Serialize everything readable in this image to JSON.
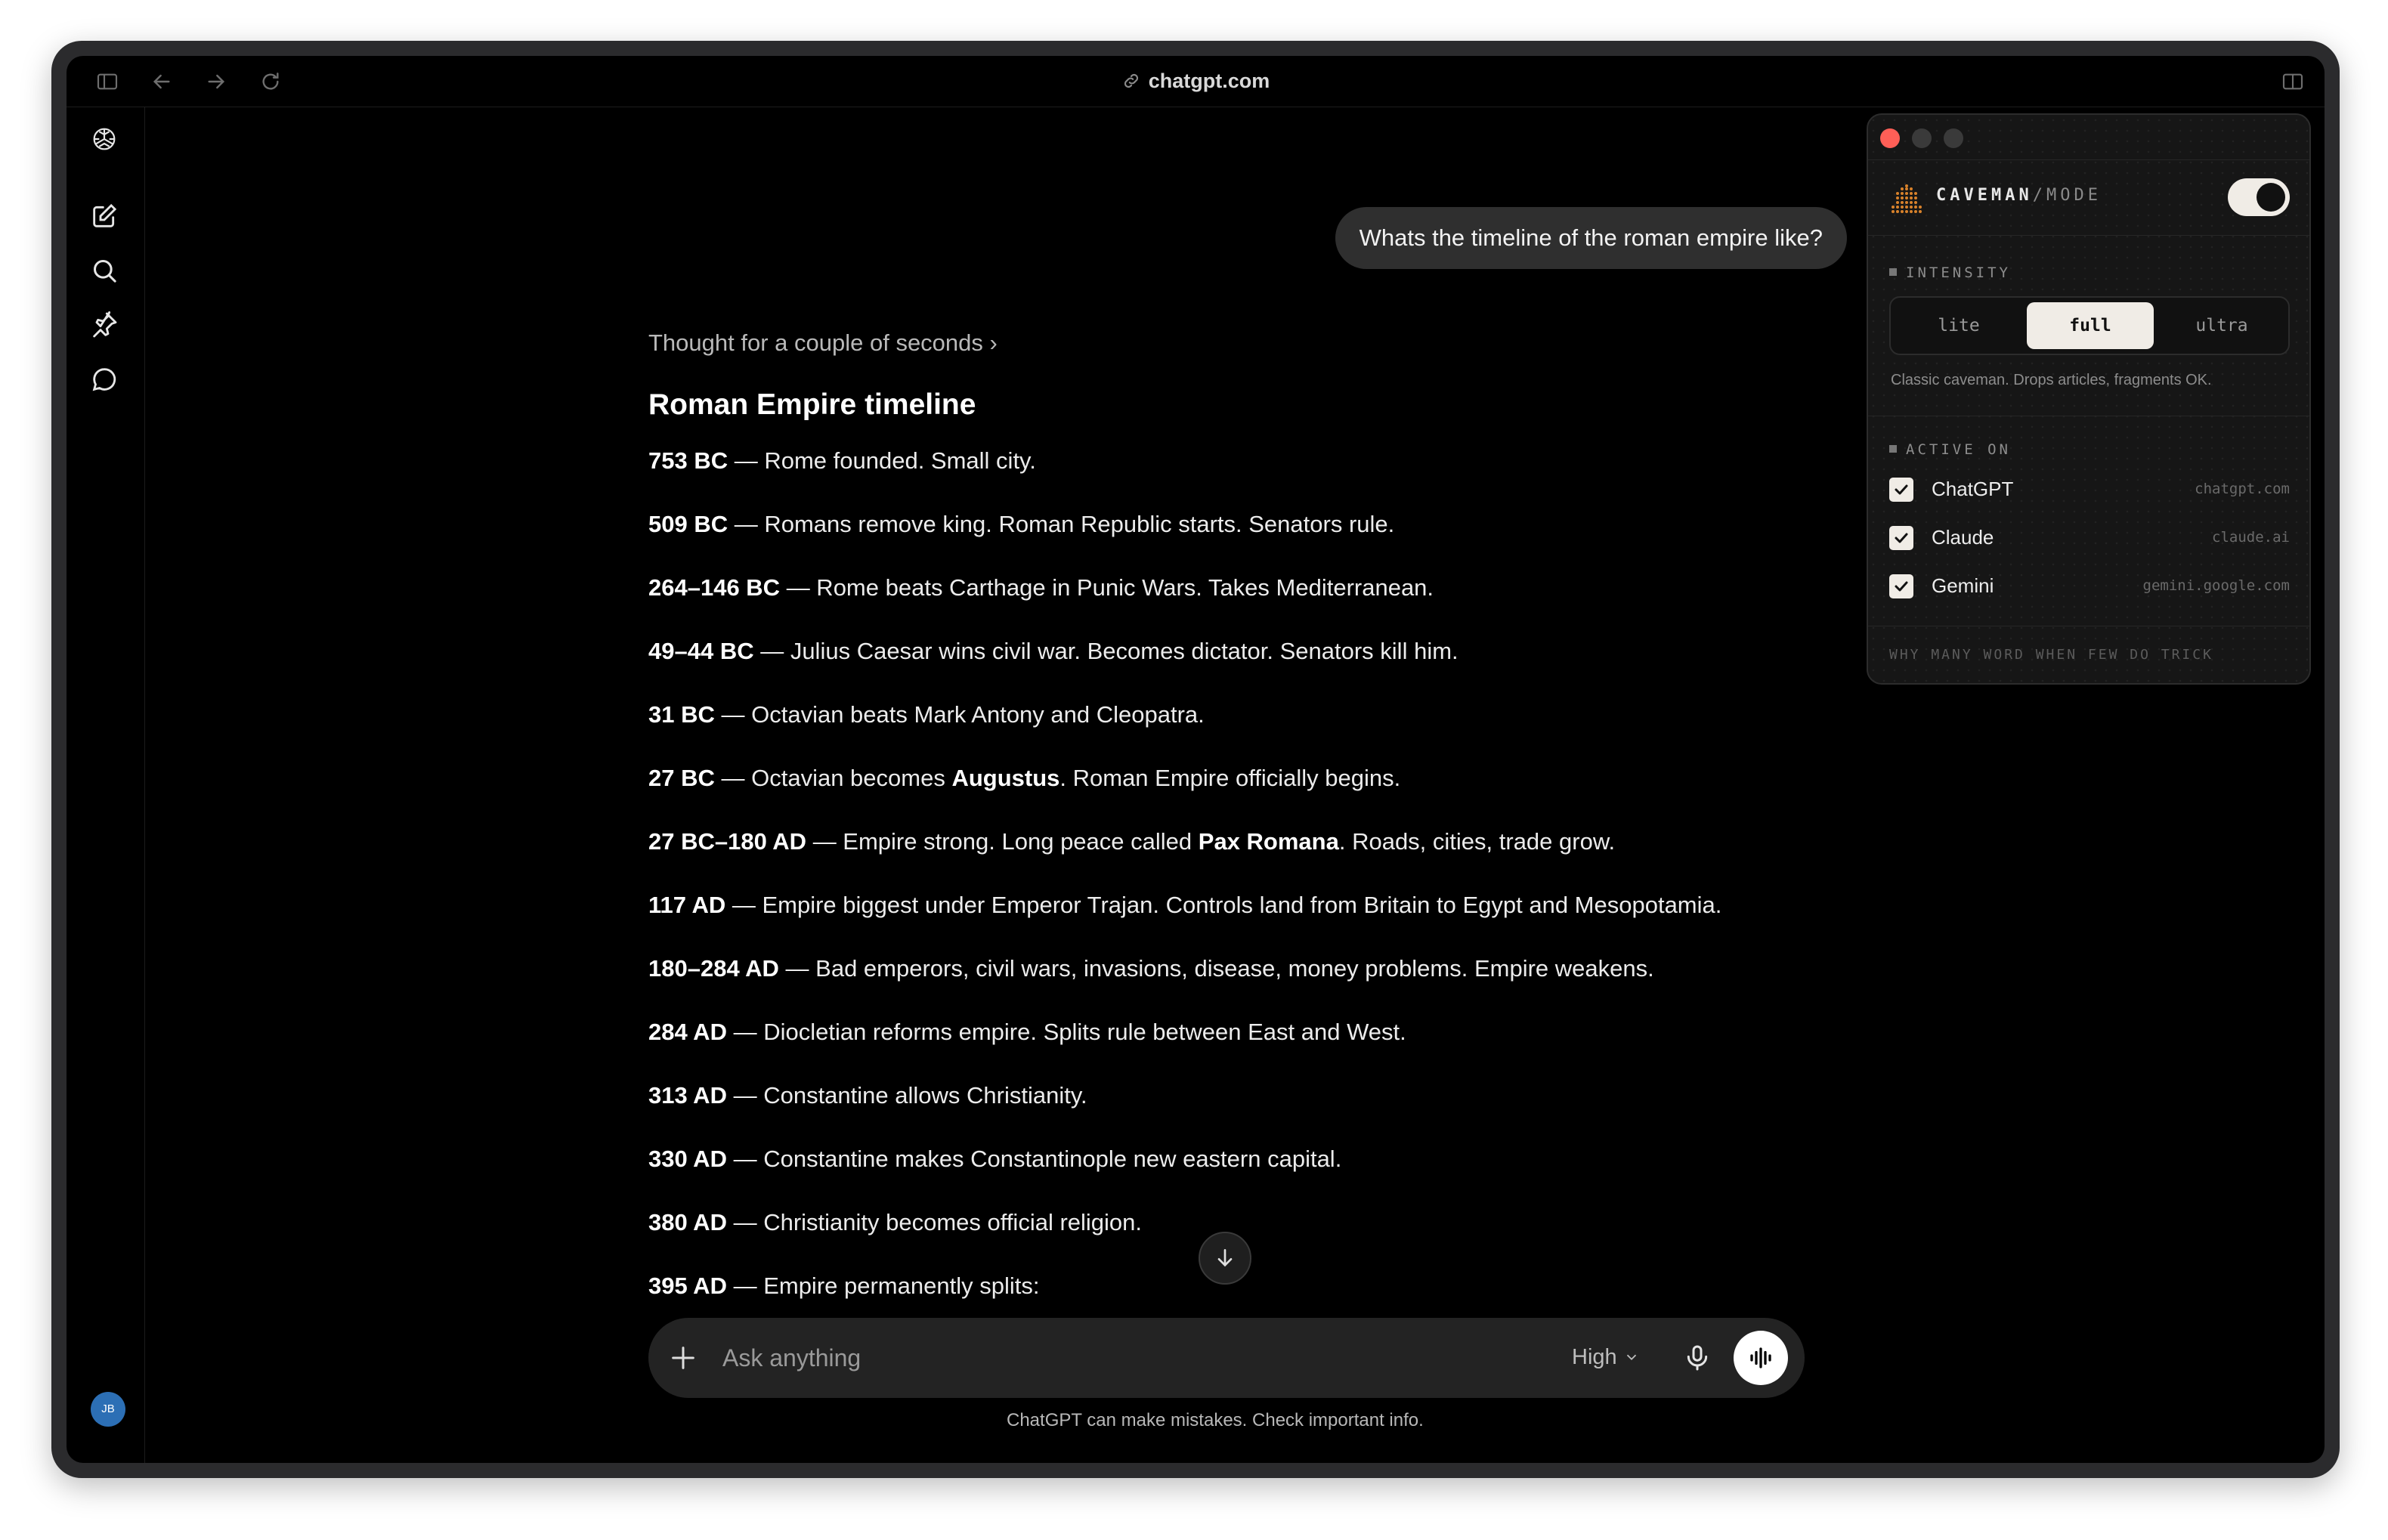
{
  "browser": {
    "url": "chatgpt.com"
  },
  "chat": {
    "user_message": "Whats the timeline of the roman empire like?",
    "thought_label": "Thought for a couple of seconds ›",
    "answer_title": "Roman Empire timeline",
    "timeline": [
      {
        "date": "753 BC",
        "text": " — Rome founded. Small city."
      },
      {
        "date": "509 BC",
        "text": " — Romans remove king. Roman Republic starts. Senators rule."
      },
      {
        "date": "264–146 BC",
        "text": " — Rome beats Carthage in Punic Wars. Takes Mediterranean."
      },
      {
        "date": "49–44 BC",
        "text": " — Julius Caesar wins civil war. Becomes dictator. Senators kill him."
      },
      {
        "date": "31 BC",
        "text": " — Octavian beats Mark Antony and Cleopatra."
      },
      {
        "date": "27 BC",
        "text": " — Octavian becomes ",
        "bold": "Augustus",
        "after": ". Roman Empire officially begins."
      },
      {
        "date": "27 BC–180 AD",
        "text": " — Empire strong. Long peace called ",
        "bold": "Pax Romana",
        "after": ". Roads, cities, trade grow."
      },
      {
        "date": "117 AD",
        "text": " — Empire biggest under Emperor Trajan. Controls land from Britain to Egypt and Mesopotamia."
      },
      {
        "date": "180–284 AD",
        "text": " — Bad emperors, civil wars, invasions, disease, money problems. Empire weakens."
      },
      {
        "date": "284 AD",
        "text": " — Diocletian reforms empire. Splits rule between East and West."
      },
      {
        "date": "313 AD",
        "text": " — Constantine allows Christianity."
      },
      {
        "date": "330 AD",
        "text": " — Constantine makes Constantinople new eastern capital."
      },
      {
        "date": "380 AD",
        "text": " — Christianity becomes official religion."
      },
      {
        "date": "395 AD",
        "text": " — Empire permanently splits:"
      }
    ]
  },
  "composer": {
    "placeholder": "Ask anything",
    "model_effort": "High",
    "disclaimer": "ChatGPT can make mistakes. Check important info."
  },
  "user": {
    "initials": "JB",
    "avatar_color": "#2c6fb5"
  },
  "extension": {
    "brand_name": "CAVEMAN",
    "brand_slash": "/",
    "brand_mode": "MODE",
    "enabled": true,
    "intensity_label": "INTENSITY",
    "intensity_options": [
      "lite",
      "full",
      "ultra"
    ],
    "intensity_selected": "full",
    "intensity_description": "Classic caveman. Drops articles, fragments OK.",
    "active_on_label": "ACTIVE ON",
    "sites": [
      {
        "name": "ChatGPT",
        "host": "chatgpt.com",
        "checked": true
      },
      {
        "name": "Claude",
        "host": "claude.ai",
        "checked": true
      },
      {
        "name": "Gemini",
        "host": "gemini.google.com",
        "checked": true
      }
    ],
    "motto": "WHY MANY WORD WHEN FEW DO TRICK",
    "colors": {
      "close": "#ff5f57",
      "inactive_light": "#3a3a3a",
      "accent_cream": "#f0ece6",
      "logo_orange": "#d9822b"
    }
  }
}
